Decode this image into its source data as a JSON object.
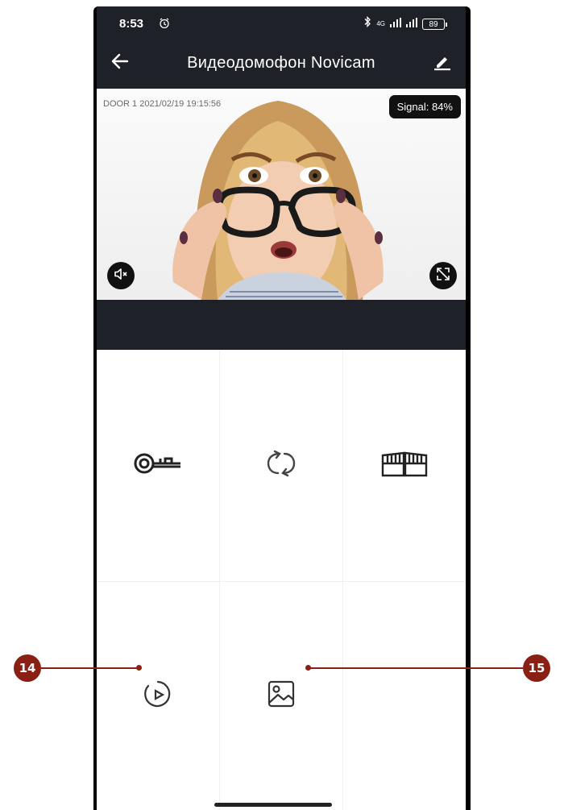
{
  "status_bar": {
    "time": "8:53",
    "network": "4G",
    "battery": "89"
  },
  "app_bar": {
    "title": "Видеодомофон Novicam"
  },
  "video": {
    "overlay": "DOOR 1 2021/02/19 19:15:56",
    "signal_label": "Signal: 84%"
  },
  "controls": [
    {
      "name": "unlock-door",
      "icon": "key-icon"
    },
    {
      "name": "switch-camera",
      "icon": "refresh-icon"
    },
    {
      "name": "open-gate",
      "icon": "gate-icon"
    },
    {
      "name": "playback",
      "icon": "playback-icon"
    },
    {
      "name": "gallery",
      "icon": "image-icon"
    }
  ],
  "callouts": {
    "left": "14",
    "right": "15"
  },
  "colors": {
    "header_bg": "#1f2128",
    "callout": "#8a1f14"
  }
}
